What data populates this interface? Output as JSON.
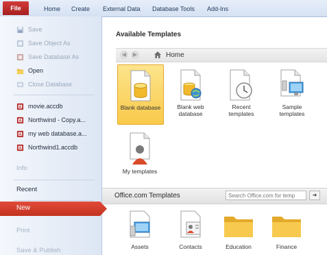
{
  "ribbon": {
    "tabs": [
      "File",
      "Home",
      "Create",
      "External Data",
      "Database Tools",
      "Add-Ins"
    ]
  },
  "leftnav": {
    "items": [
      {
        "label": "Save",
        "icon": "save-icon",
        "disabled": true
      },
      {
        "label": "Save Object As",
        "icon": "save-object-icon",
        "disabled": true
      },
      {
        "label": "Save Database As",
        "icon": "save-database-icon",
        "disabled": true
      },
      {
        "label": "Open",
        "icon": "open-folder-icon",
        "disabled": false
      },
      {
        "label": "Close Database",
        "icon": "close-database-icon",
        "disabled": true
      }
    ],
    "recent_files": [
      "movie.accdb",
      "Northwind - Copy.a...",
      "my web database.a...",
      "Northwind1.accdb"
    ],
    "sections": {
      "info": "Info",
      "recent": "Recent",
      "new": "New",
      "print": "Print",
      "save_publish": "Save & Publish"
    }
  },
  "main": {
    "heading": "Available Templates",
    "breadcrumb": "Home",
    "templates": [
      {
        "label": "Blank database",
        "icon": "blank-database-icon",
        "selected": true
      },
      {
        "label": "Blank web database",
        "icon": "blank-web-database-icon",
        "selected": false
      },
      {
        "label": "Recent templates",
        "icon": "recent-templates-icon",
        "selected": false
      },
      {
        "label": "Sample templates",
        "icon": "sample-templates-icon",
        "selected": false
      },
      {
        "label": "My templates",
        "icon": "my-templates-icon",
        "selected": false
      }
    ],
    "office": {
      "title": "Office.com Templates",
      "search_placeholder": "Search Office.com for temp",
      "categories": [
        {
          "label": "Assets",
          "icon": "assets-icon"
        },
        {
          "label": "Contacts",
          "icon": "contacts-icon"
        },
        {
          "label": "Education",
          "icon": "education-folder-icon"
        },
        {
          "label": "Finance",
          "icon": "finance-folder-icon"
        }
      ]
    }
  },
  "colors": {
    "file_tab": "#c0282a",
    "new_highlight": "#d7402e",
    "selected_tile": "#f9d361",
    "ribbon_bg": "#dce6f4"
  }
}
